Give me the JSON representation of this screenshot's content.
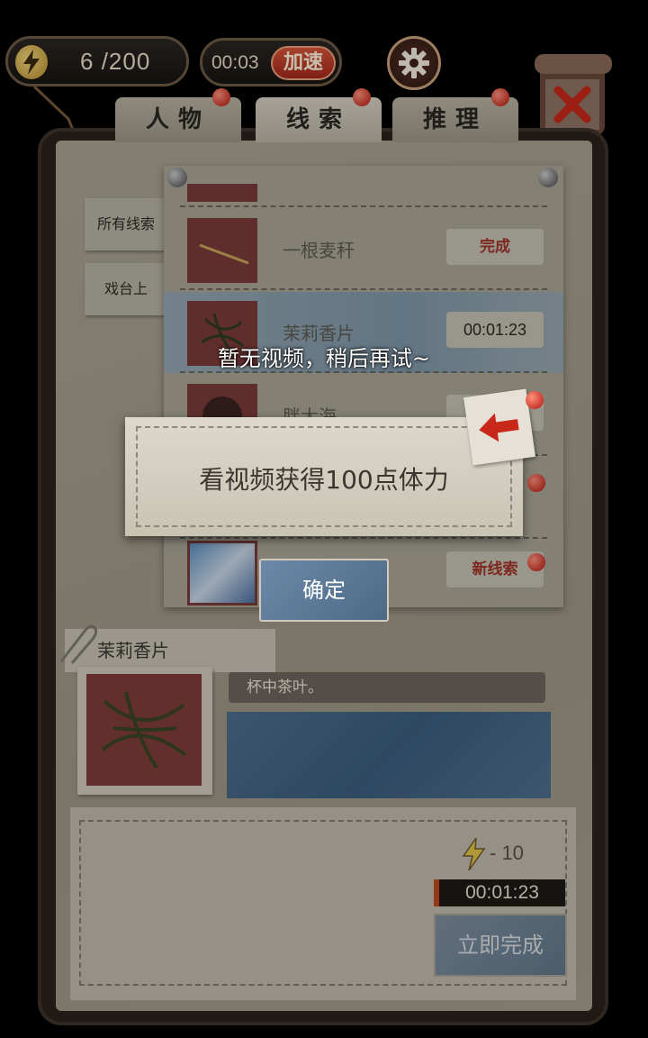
{
  "hud": {
    "energy_current": "6",
    "energy_max": "/200",
    "timer": "00:03",
    "speed_label": "加速"
  },
  "tabs": [
    {
      "label": "人物",
      "active": false
    },
    {
      "label": "线索",
      "active": true
    },
    {
      "label": "推理",
      "active": false
    }
  ],
  "filters": [
    "所有线索",
    "戏台上"
  ],
  "clues": [
    {
      "name": "一根麦秆",
      "status": "完成"
    },
    {
      "name": "茉莉香片",
      "status": "00:01:23"
    },
    {
      "name": "胖大海",
      "status": ""
    },
    {
      "name": "",
      "status": "新线索"
    }
  ],
  "toast": "暂无视频，稍后再试~",
  "dialog": {
    "message": "看视频获得100点体力",
    "confirm_label": "确定"
  },
  "detail": {
    "title": "茉莉香片",
    "description": "杯中茶叶。"
  },
  "task": {
    "cost": "- 10",
    "timer": "00:01:23",
    "finish_label": "立即完成"
  },
  "colors": {
    "accent_red": "#b3150c",
    "selected_blue": "#7e97a9",
    "paper": "#a9a392"
  }
}
